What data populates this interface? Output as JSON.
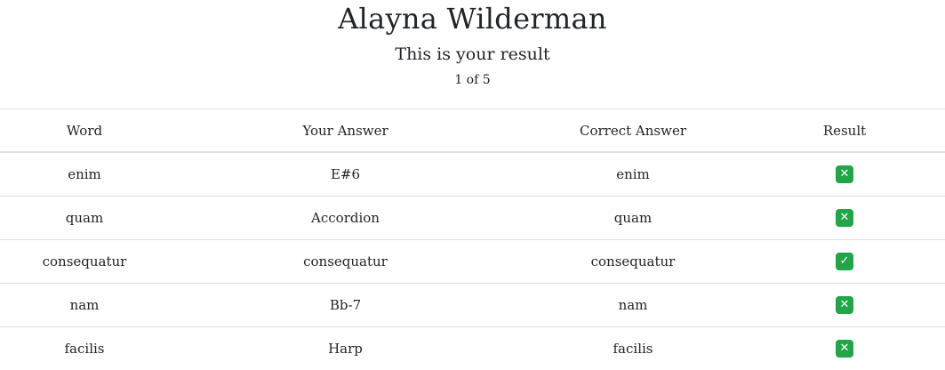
{
  "header": {
    "name": "Alayna Wilderman",
    "subtitle": "This is your result",
    "pager": "1 of 5"
  },
  "table": {
    "columns": [
      "Word",
      "Your Answer",
      "Correct Answer",
      "Result"
    ],
    "rows": [
      {
        "word": "enim",
        "your_answer": "E#6",
        "correct_answer": "enim",
        "result": "wrong",
        "result_icon": "cross-mark-icon"
      },
      {
        "word": "quam",
        "your_answer": "Accordion",
        "correct_answer": "quam",
        "result": "wrong",
        "result_icon": "cross-mark-icon"
      },
      {
        "word": "consequatur",
        "your_answer": "consequatur",
        "correct_answer": "consequatur",
        "result": "right",
        "result_icon": "check-mark-icon"
      },
      {
        "word": "nam",
        "your_answer": "Bb-7",
        "correct_answer": "nam",
        "result": "wrong",
        "result_icon": "cross-mark-icon"
      },
      {
        "word": "facilis",
        "your_answer": "Harp",
        "correct_answer": "facilis",
        "result": "wrong",
        "result_icon": "cross-mark-icon"
      }
    ]
  },
  "colors": {
    "result_badge": "#22a447",
    "border": "#dee2e6",
    "text": "#212529"
  }
}
